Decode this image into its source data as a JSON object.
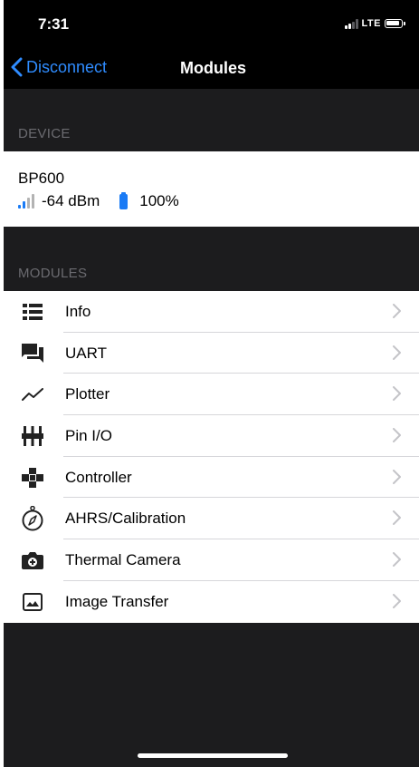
{
  "status_bar": {
    "time": "7:31",
    "network": "LTE"
  },
  "nav": {
    "back_label": "Disconnect",
    "title": "Modules"
  },
  "device_section": {
    "header": "DEVICE",
    "name": "BP600",
    "rssi": "-64 dBm",
    "battery": "100%"
  },
  "modules_section": {
    "header": "MODULES",
    "items": [
      {
        "label": "Info",
        "icon": "list-icon"
      },
      {
        "label": "UART",
        "icon": "chat-icon"
      },
      {
        "label": "Plotter",
        "icon": "chart-line-icon"
      },
      {
        "label": "Pin I/O",
        "icon": "pins-icon"
      },
      {
        "label": "Controller",
        "icon": "gamepad-icon"
      },
      {
        "label": "AHRS/Calibration",
        "icon": "compass-icon"
      },
      {
        "label": "Thermal Camera",
        "icon": "camera-icon"
      },
      {
        "label": "Image Transfer",
        "icon": "image-icon"
      }
    ]
  },
  "colors": {
    "accent": "#2f8cff",
    "battery": "#1a7bf5",
    "background": "#1c1c1e"
  }
}
